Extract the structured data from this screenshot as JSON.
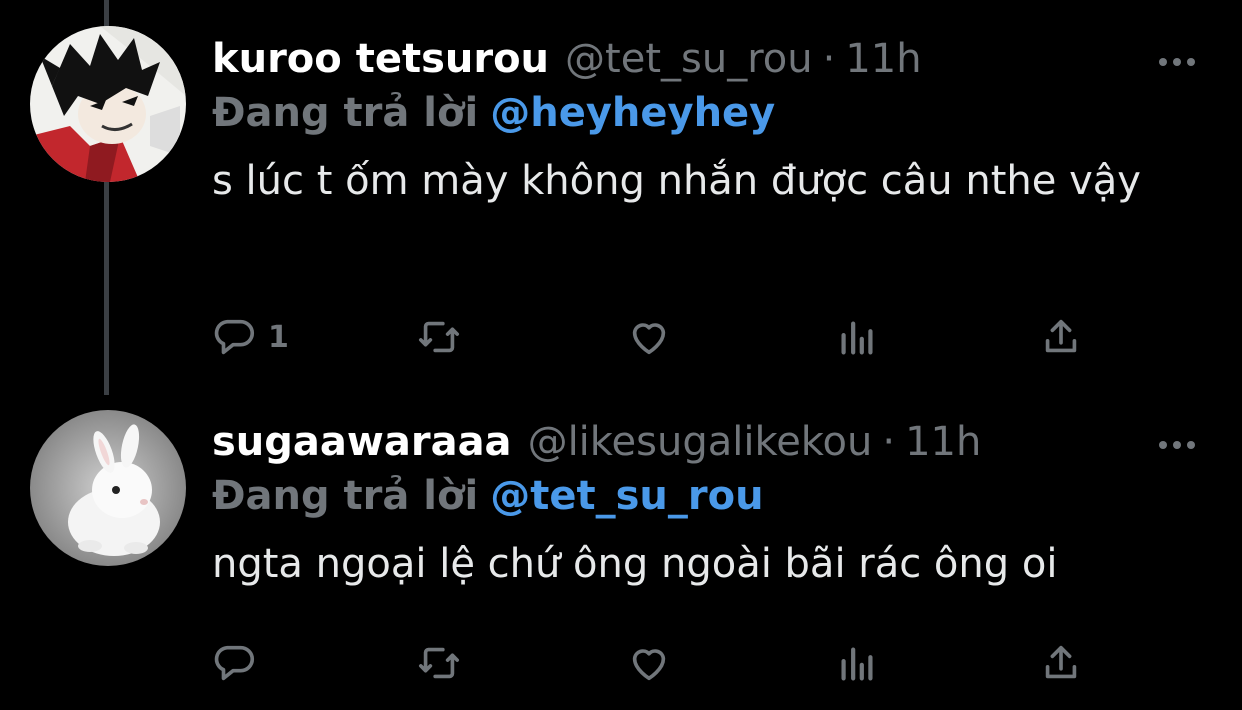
{
  "tweets": [
    {
      "display_name": "kuroo tetsurou",
      "handle": "@tet_su_rou",
      "separator": "·",
      "time": "11h",
      "reply_label": "Đang trả lời",
      "reply_to": "@heyheyhey",
      "text": "s lúc t ốm mày không nhắn được câu nthe vậy",
      "reply_count": "1"
    },
    {
      "display_name": "sugaawaraaa",
      "handle": "@likesugalikekou",
      "separator": "·",
      "time": "11h",
      "reply_label": "Đang trả lời",
      "reply_to": "@tet_su_rou",
      "text": "ngta ngoại lệ chứ ông ngoài bãi rác ông oi",
      "reply_count": ""
    }
  ],
  "icons": {
    "reply": "reply-icon",
    "retweet": "retweet-icon",
    "like": "heart-icon",
    "views": "views-icon",
    "share": "share-icon",
    "more": "more-icon"
  },
  "colors": {
    "background": "#000000",
    "text": "#e7e9ea",
    "muted": "#71767b",
    "mention": "#4a99e9",
    "thread_line": "#3b3f44"
  }
}
